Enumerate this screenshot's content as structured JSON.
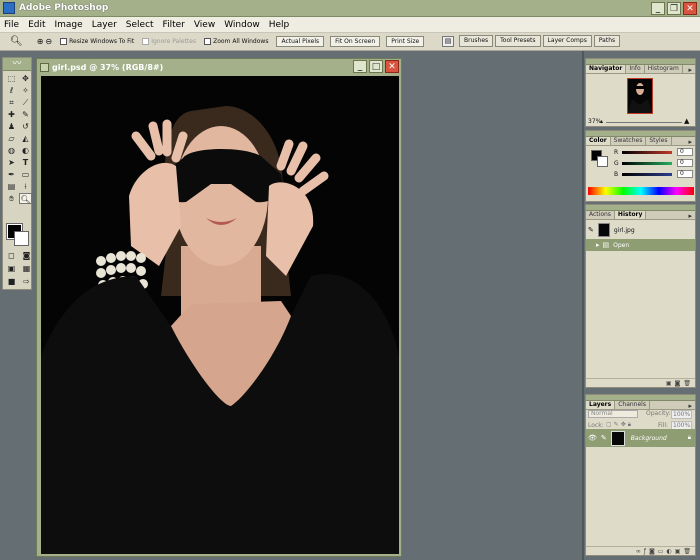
{
  "app": {
    "title": "Adobe Photoshop"
  },
  "menu": [
    "File",
    "Edit",
    "Image",
    "Layer",
    "Select",
    "Filter",
    "View",
    "Window",
    "Help"
  ],
  "options": {
    "resize_windows": "Resize Windows To Fit",
    "ignore_palettes": "Ignore Palettes",
    "zoom_all": "Zoom All Windows",
    "actual_pixels": "Actual Pixels",
    "fit_on_screen": "Fit On Screen",
    "print_size": "Print Size"
  },
  "palette_well": [
    "Brushes",
    "Tool Presets",
    "Layer Comps",
    "Paths"
  ],
  "document": {
    "title": "girl.psd @ 37% (RGB/8#)"
  },
  "navigator": {
    "tabs": [
      "Navigator",
      "Info",
      "Histogram"
    ],
    "zoom": "37%"
  },
  "color": {
    "tabs": [
      "Color",
      "Swatches",
      "Styles"
    ],
    "channels": [
      {
        "label": "R",
        "value": "0",
        "color": "#c0392b"
      },
      {
        "label": "G",
        "value": "0",
        "color": "#27ae60"
      },
      {
        "label": "B",
        "value": "0",
        "color": "#2c3e8f"
      }
    ]
  },
  "history": {
    "tabs": [
      "Actions",
      "History"
    ],
    "snapshot": "girl.jpg",
    "items": [
      "Open"
    ]
  },
  "layers": {
    "tabs": [
      "Layers",
      "Channels"
    ],
    "blend": "Normal",
    "opacity_label": "Opacity:",
    "opacity": "100%",
    "lock_label": "Lock:",
    "fill_label": "Fill:",
    "fill": "100%",
    "layer_name": "Background"
  },
  "colors": {
    "chrome": "#a3b08a",
    "workspace": "#656f73",
    "selection": "#8f9d73"
  }
}
